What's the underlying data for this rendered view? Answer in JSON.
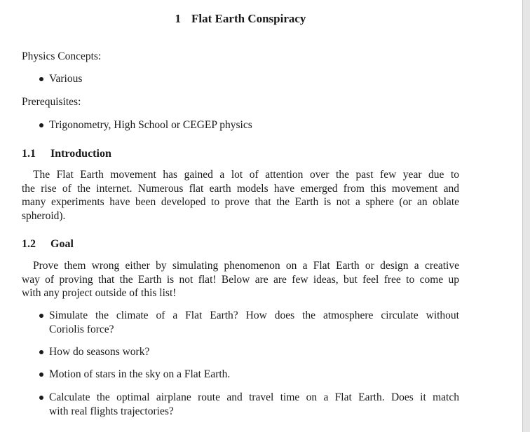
{
  "title": {
    "number": "1",
    "text": "Flat Earth Conspiracy"
  },
  "physics_concepts": {
    "label": "Physics Concepts:",
    "items": [
      "Various"
    ]
  },
  "prerequisites": {
    "label": "Prerequisites:",
    "items": [
      "Trigonometry, High School or CEGEP physics"
    ]
  },
  "introduction": {
    "number": "1.1",
    "heading": "Introduction",
    "lines": [
      "The Flat Earth movement has gained a lot of attention over the past few year due to",
      "the rise of the internet. Numerous flat earth models have emerged from this movement and",
      "many experiments have been developed to prove that the Earth is not a sphere (or an oblate",
      "spheroid)."
    ]
  },
  "goal": {
    "number": "1.2",
    "heading": "Goal",
    "lines": [
      "Prove them wrong either by simulating phenomenon on a Flat Earth or design a creative",
      "way of proving that the Earth is not flat! Below are are few ideas, but feel free to come up",
      "with any project outside of this list!"
    ],
    "ideas": [
      {
        "lines": [
          "Simulate the climate of a Flat Earth? How does the atmosphere circulate without",
          "Coriolis force?"
        ]
      },
      {
        "lines": [
          "How do seasons work?"
        ]
      },
      {
        "lines": [
          "Motion of stars in the sky on a Flat Earth."
        ]
      },
      {
        "lines": [
          "Calculate the optimal airplane route and travel time on a Flat Earth. Does it match",
          "with real flights trajectories?"
        ]
      }
    ]
  }
}
